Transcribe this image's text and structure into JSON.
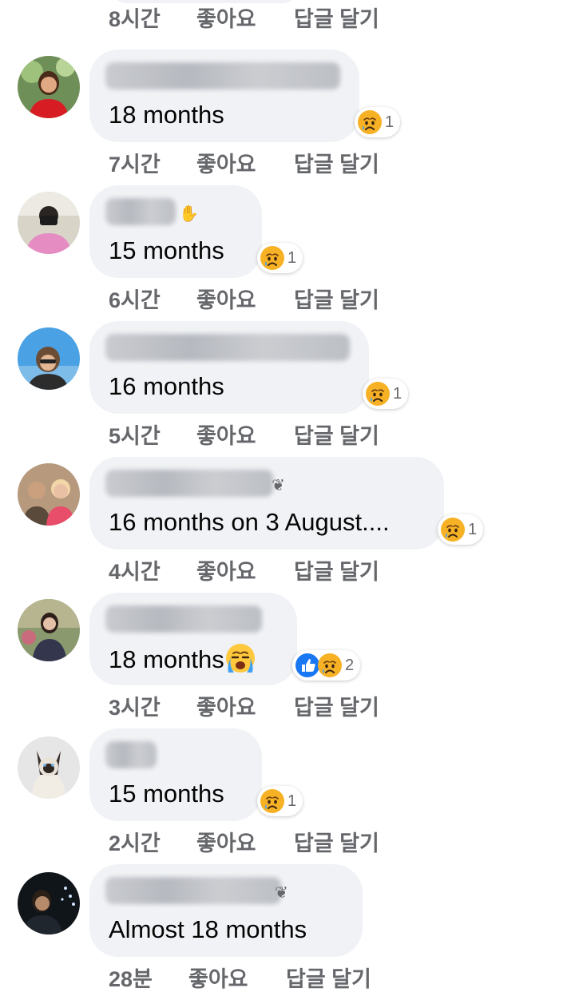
{
  "top_actions": {
    "time": "8시간",
    "like": "좋아요",
    "reply": "답글 달기"
  },
  "comments": [
    {
      "text": "18 months",
      "reaction": {
        "types": [
          "sad"
        ],
        "count": "1"
      },
      "actions": {
        "time": "7시간",
        "like": "좋아요",
        "reply": "답글 달기"
      }
    },
    {
      "badge": "wave",
      "text": "15 months",
      "reaction": {
        "types": [
          "sad"
        ],
        "count": "1"
      },
      "actions": {
        "time": "6시간",
        "like": "좋아요",
        "reply": "답글 달기"
      }
    },
    {
      "text": "16 months",
      "reaction": {
        "types": [
          "sad"
        ],
        "count": "1"
      },
      "actions": {
        "time": "5시간",
        "like": "좋아요",
        "reply": "답글 달기"
      }
    },
    {
      "badge": "new-member",
      "text": "16 months on 3 August....",
      "reaction": {
        "types": [
          "sad"
        ],
        "count": "1"
      },
      "actions": {
        "time": "4시간",
        "like": "좋아요",
        "reply": "답글 달기"
      }
    },
    {
      "text": "18 months",
      "inline_emoji": "loudly-crying",
      "reaction": {
        "types": [
          "like",
          "sad"
        ],
        "count": "2"
      },
      "actions": {
        "time": "3시간",
        "like": "좋아요",
        "reply": "답글 달기"
      }
    },
    {
      "text": "15 months",
      "reaction": {
        "types": [
          "sad"
        ],
        "count": "1"
      },
      "actions": {
        "time": "2시간",
        "like": "좋아요",
        "reply": "답글 달기"
      }
    },
    {
      "badge": "new-member",
      "text": "Almost 18 months",
      "actions": {
        "time": "28분",
        "like": "좋아요",
        "reply": "답글 달기"
      }
    }
  ],
  "colors": {
    "bubble": "#f0f2f5",
    "meta_text": "#65676b",
    "comment_text": "#050505",
    "like_blue": "#1877f2",
    "sad_yellow": "#f7b125"
  }
}
